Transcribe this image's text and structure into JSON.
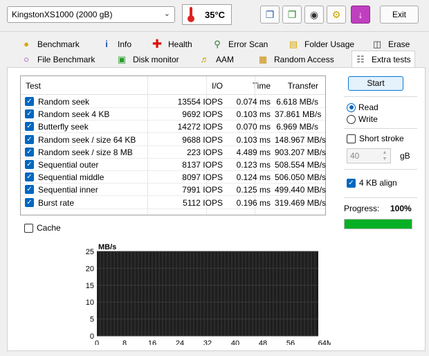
{
  "drive": {
    "selected": "KingstonXS1000 (2000 gB)"
  },
  "temperature": "35°C",
  "toolbar": {
    "exit_label": "Exit"
  },
  "tabs_row1": [
    {
      "label": "Benchmark",
      "icon": "benchmark-icon"
    },
    {
      "label": "Info",
      "icon": "info-icon"
    },
    {
      "label": "Health",
      "icon": "health-icon"
    },
    {
      "label": "Error Scan",
      "icon": "error-scan-icon"
    },
    {
      "label": "Folder Usage",
      "icon": "folder-icon"
    },
    {
      "label": "Erase",
      "icon": "erase-icon"
    }
  ],
  "tabs_row2": [
    {
      "label": "File Benchmark",
      "icon": "file-benchmark-icon"
    },
    {
      "label": "Disk monitor",
      "icon": "disk-monitor-icon"
    },
    {
      "label": "AAM",
      "icon": "speaker-icon"
    },
    {
      "label": "Random Access",
      "icon": "random-access-icon"
    },
    {
      "label": "Extra tests",
      "icon": "extra-tests-icon",
      "active": true
    }
  ],
  "table": {
    "headers": [
      "Test",
      "I/O",
      "Time",
      "Transfer"
    ],
    "rows": [
      {
        "test": "Random seek",
        "io": "13554 IOPS",
        "time": "0.074 ms",
        "transfer": "6.618 MB/s"
      },
      {
        "test": "Random seek 4 KB",
        "io": "9692 IOPS",
        "time": "0.103 ms",
        "transfer": "37.861 MB/s"
      },
      {
        "test": "Butterfly seek",
        "io": "14272 IOPS",
        "time": "0.070 ms",
        "transfer": "6.969 MB/s"
      },
      {
        "test": "Random seek / size 64 KB",
        "io": "9688 IOPS",
        "time": "0.103 ms",
        "transfer": "148.967 MB/s"
      },
      {
        "test": "Random seek / size 8 MB",
        "io": "223 IOPS",
        "time": "4.489 ms",
        "transfer": "903.207 MB/s"
      },
      {
        "test": "Sequential outer",
        "io": "8137 IOPS",
        "time": "0.123 ms",
        "transfer": "508.554 MB/s"
      },
      {
        "test": "Sequential middle",
        "io": "8097 IOPS",
        "time": "0.124 ms",
        "transfer": "506.050 MB/s"
      },
      {
        "test": "Sequential inner",
        "io": "7991 IOPS",
        "time": "0.125 ms",
        "transfer": "499.440 MB/s"
      },
      {
        "test": "Burst rate",
        "io": "5112 IOPS",
        "time": "0.196 ms",
        "transfer": "319.469 MB/s"
      }
    ]
  },
  "cache_label": "Cache",
  "controls": {
    "start_label": "Start",
    "read_label": "Read",
    "write_label": "Write",
    "short_stroke_label": "Short stroke",
    "stroke_value": "40",
    "stroke_unit": "gB",
    "align_label": "4 KB align",
    "progress_label": "Progress:",
    "progress_value": "100%",
    "progress_fraction": 1.0
  },
  "chart_data": {
    "type": "line",
    "ylabel": "MB/s",
    "xlabel": "64MB",
    "ylim": [
      0,
      25
    ],
    "xlim": [
      0,
      64
    ],
    "yticks": [
      "25",
      "20",
      "15",
      "10",
      "5",
      "0"
    ],
    "xticks": [
      "0",
      "8",
      "16",
      "24",
      "32",
      "40",
      "48",
      "56",
      "64MB"
    ],
    "grid": true,
    "series": []
  }
}
